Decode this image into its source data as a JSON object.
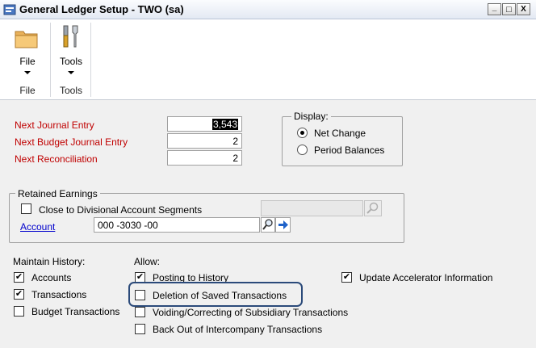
{
  "window": {
    "title": "General Ledger Setup  -  TWO (sa)",
    "buttons": {
      "minimize": "_",
      "maximize": "□",
      "close": "X"
    }
  },
  "ribbon": {
    "file_button": "File",
    "file_group": "File",
    "tools_button": "Tools",
    "tools_group": "Tools"
  },
  "fields": {
    "next_journal_label": "Next Journal Entry",
    "next_journal_value": "3,543",
    "next_budget_label": "Next Budget Journal Entry",
    "next_budget_value": "2",
    "next_reconciliation_label": "Next Reconciliation",
    "next_reconciliation_value": "2"
  },
  "display": {
    "legend": "Display:",
    "net_change": "Net Change",
    "period_balances": "Period Balances",
    "selected": "Net Change"
  },
  "retained": {
    "legend": "Retained Earnings",
    "close_label": "Close to Divisional Account Segments",
    "close_checked": false,
    "account_label": "Account",
    "account_value": "000 -3030 -00"
  },
  "maintain": {
    "heading": "Maintain History:",
    "accounts": "Accounts",
    "accounts_checked": true,
    "transactions": "Transactions",
    "transactions_checked": true,
    "budget": "Budget Transactions",
    "budget_checked": false
  },
  "allow": {
    "heading": "Allow:",
    "posting": "Posting to History",
    "posting_checked": true,
    "deletion": "Deletion of Saved Transactions",
    "deletion_checked": false,
    "voiding": "Voiding/Correcting of Subsidiary Transactions",
    "voiding_checked": false,
    "backout": "Back Out of Intercompany Transactions",
    "backout_checked": false
  },
  "accelerator": {
    "label": "Update Accelerator Information",
    "checked": true
  },
  "colors": {
    "highlight_border": "#2b4a7a",
    "required_label": "#c00000",
    "link": "#0000cc"
  }
}
